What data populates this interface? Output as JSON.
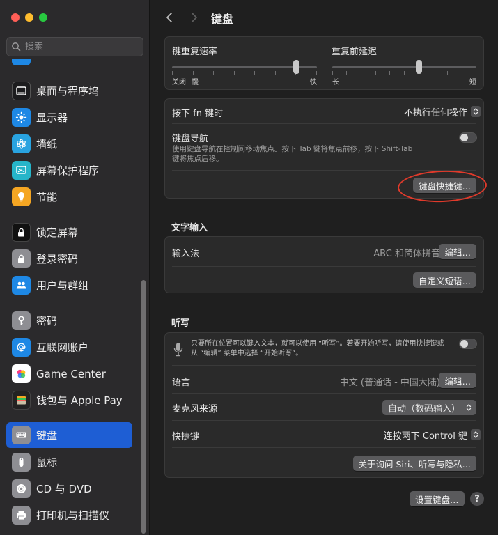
{
  "window": {
    "title": "键盘"
  },
  "search": {
    "placeholder": "搜索"
  },
  "sidebar": {
    "items": [
      {
        "label": "桌面与程序坞",
        "icon": "dock-icon",
        "color": "#2b2b2b"
      },
      {
        "label": "显示器",
        "icon": "sun-icon",
        "color": "#1e88e5"
      },
      {
        "label": "墙纸",
        "icon": "flower-icon",
        "color": "#29a3e0"
      },
      {
        "label": "屏幕保护程序",
        "icon": "screensaver-icon",
        "color": "#26b5c9"
      },
      {
        "label": "节能",
        "icon": "lightbulb-icon",
        "color": "#f5a623"
      },
      {
        "label": "锁定屏幕",
        "icon": "lock-icon",
        "color": "#111111"
      },
      {
        "label": "登录密码",
        "icon": "padlock-icon",
        "color": "#8e8e93"
      },
      {
        "label": "用户与群组",
        "icon": "users-icon",
        "color": "#1e88e5"
      },
      {
        "label": "密码",
        "icon": "key-icon",
        "color": "#8e8e93"
      },
      {
        "label": "互联网账户",
        "icon": "at-icon",
        "color": "#1e88e5"
      },
      {
        "label": "Game Center",
        "icon": "game-center-icon",
        "color": "#ffffff"
      },
      {
        "label": "钱包与 Apple Pay",
        "icon": "wallet-icon",
        "color": "#222222"
      },
      {
        "label": "键盘",
        "icon": "keyboard-icon",
        "color": "#8e8e93",
        "selected": true
      },
      {
        "label": "鼠标",
        "icon": "mouse-icon",
        "color": "#8e8e93"
      },
      {
        "label": "CD 与 DVD",
        "icon": "disc-icon",
        "color": "#8e8e93"
      },
      {
        "label": "打印机与扫描仪",
        "icon": "printer-icon",
        "color": "#8e8e93"
      }
    ]
  },
  "keyboard": {
    "repeat_rate": {
      "label": "键重复速率",
      "min_label": "关闭",
      "min2_label": "慢",
      "max_label": "快",
      "value_fraction": 0.86
    },
    "repeat_delay": {
      "label": "重复前延迟",
      "min_label": "长",
      "max_label": "短",
      "value_fraction": 0.6
    },
    "fn_key": {
      "label": "按下 fn 键时",
      "value": "不执行任何操作"
    },
    "nav": {
      "label": "键盘导航",
      "description_1": "使用键盘导航在控制间移动焦点。按下 Tab 键将焦点前移，按下 Shift-Tab",
      "description_2": "键将焦点后移。",
      "enabled": false
    },
    "shortcuts_button": "键盘快捷键…"
  },
  "text_input": {
    "section_title": "文字输入",
    "input_method_label": "输入法",
    "input_method_value": "ABC 和简体拼音",
    "edit_button": "编辑…",
    "replacements_button": "自定义短语…"
  },
  "dictation": {
    "section_title": "听写",
    "description_1": "只要所在位置可以键入文本，就可以使用 “听写”。若要开始听写，请使用快捷键或",
    "description_2": "从 “编辑” 菜单中选择 “开始听写”。",
    "enabled": false,
    "language_label": "语言",
    "language_value": "中文 (普通话 - 中国大陆)",
    "language_edit": "编辑…",
    "mic_label": "麦克风来源",
    "mic_value": "自动（数码输入）",
    "shortcut_label": "快捷键",
    "shortcut_value": "连按两下 Control 键",
    "privacy_button": "关于询问 Siri、听写与隐私…"
  },
  "footer": {
    "setup_button": "设置键盘…",
    "help": "?"
  },
  "colors": {
    "accent": "#1e5ed4",
    "annotation": "#e03a2b"
  }
}
